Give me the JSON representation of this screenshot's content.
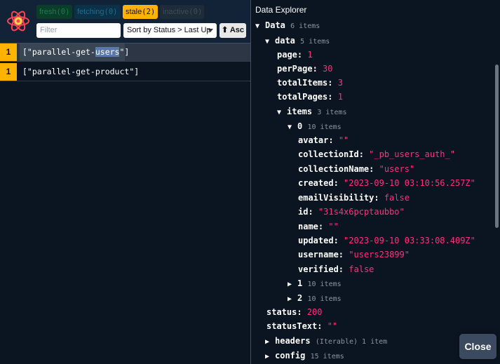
{
  "status_filters": {
    "fresh": {
      "label": "fresh",
      "count": "(0)"
    },
    "fetching": {
      "label": "fetching",
      "count": "(0)"
    },
    "stale": {
      "label": "stale",
      "count": "(2)"
    },
    "inactive": {
      "label": "inactive",
      "count": "(0)"
    }
  },
  "toolbar": {
    "filter_placeholder": "Filter",
    "sort_label": "Sort by Status > Last Up",
    "asc_label": "⬆ Asc"
  },
  "queries": [
    {
      "count": "1",
      "key_prefix": "[\"parallel-get-",
      "key_highlight": "users",
      "key_suffix": "\"]"
    },
    {
      "count": "1",
      "key": "[\"parallel-get-product\"]"
    }
  ],
  "explorer": {
    "title": "Data Explorer",
    "tree": {
      "data_root": {
        "label": "Data",
        "meta": "6 items"
      },
      "data": {
        "label": "data",
        "meta": "5 items"
      },
      "page": {
        "key": "page:",
        "value": "1"
      },
      "perPage": {
        "key": "perPage:",
        "value": "30"
      },
      "totalItems": {
        "key": "totalItems:",
        "value": "3"
      },
      "totalPages": {
        "key": "totalPages:",
        "value": "1"
      },
      "items": {
        "label": "items",
        "meta": "3 items"
      },
      "item0": {
        "label": "0",
        "meta": "10 items"
      },
      "avatar": {
        "key": "avatar:",
        "value": "\"\""
      },
      "collectionId": {
        "key": "collectionId:",
        "value": "\"_pb_users_auth_\""
      },
      "collectionName": {
        "key": "collectionName:",
        "value": "\"users\""
      },
      "created": {
        "key": "created:",
        "value": "\"2023-09-10 03:10:56.257Z\""
      },
      "emailVisibility": {
        "key": "emailVisibility:",
        "value": "false"
      },
      "id": {
        "key": "id:",
        "value": "\"31s4x6pcptaubbo\""
      },
      "name": {
        "key": "name:",
        "value": "\"\""
      },
      "updated": {
        "key": "updated:",
        "value": "\"2023-09-10 03:33:08.409Z\""
      },
      "username": {
        "key": "username:",
        "value": "\"users23899\""
      },
      "verified": {
        "key": "verified:",
        "value": "false"
      },
      "item1": {
        "label": "1",
        "meta": "10 items"
      },
      "item2": {
        "label": "2",
        "meta": "10 items"
      },
      "status": {
        "key": "status:",
        "value": "200"
      },
      "statusText": {
        "key": "statusText:",
        "value": "\"\""
      },
      "headers": {
        "label": "headers",
        "meta": "(Iterable) 1 item"
      },
      "config": {
        "label": "config",
        "meta": "15 items"
      }
    },
    "close_label": "Close"
  }
}
